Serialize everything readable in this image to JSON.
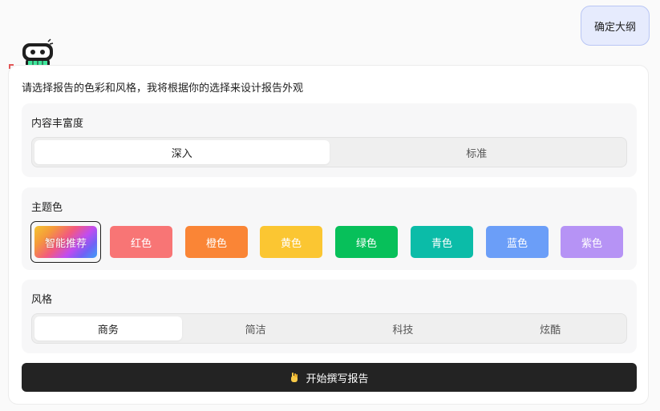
{
  "confirm_bubble": {
    "label": "确定大纲"
  },
  "card": {
    "intro": "请选择报告的色彩和风格，我将根据你的选择来设计报告外观",
    "richness": {
      "title": "内容丰富度",
      "options": [
        "深入",
        "标准"
      ],
      "selected": "深入"
    },
    "theme": {
      "title": "主题色",
      "selected": "智能推荐",
      "swatches": [
        {
          "label": "智能推荐",
          "color": "gradient"
        },
        {
          "label": "红色",
          "color": "#f87575"
        },
        {
          "label": "橙色",
          "color": "#fa8536"
        },
        {
          "label": "黄色",
          "color": "#fbc632"
        },
        {
          "label": "绿色",
          "color": "#07c05a"
        },
        {
          "label": "青色",
          "color": "#0bbca8"
        },
        {
          "label": "蓝色",
          "color": "#6b9ef8"
        },
        {
          "label": "紫色",
          "color": "#b693f5"
        }
      ]
    },
    "style": {
      "title": "风格",
      "options": [
        "商务",
        "简洁",
        "科技",
        "炫酷"
      ],
      "selected": "商务"
    },
    "start_button": {
      "label": "开始撰写报告",
      "icon": "hand-icon"
    }
  }
}
